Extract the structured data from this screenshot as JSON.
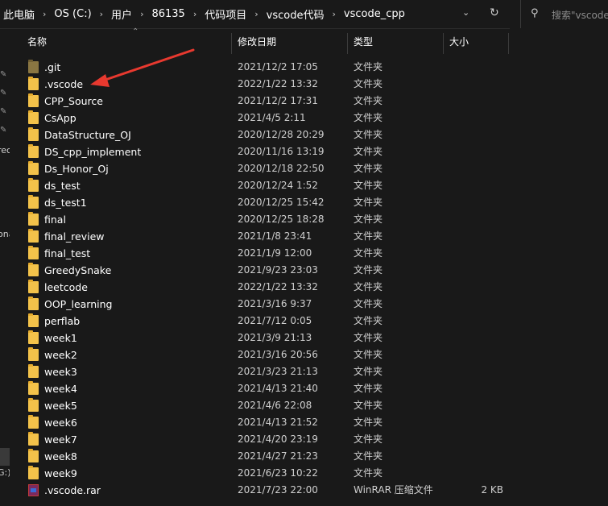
{
  "breadcrumb": [
    "此电脑",
    "OS (C:)",
    "用户",
    "86135",
    "代码项目",
    "vscode代码",
    "vscode_cpp"
  ],
  "search": {
    "placeholder": "搜索\"vscode"
  },
  "nav": {
    "labels": [
      "rec",
      "ona",
      "G:)"
    ]
  },
  "columns": {
    "name": "名称",
    "modified": "修改日期",
    "type": "类型",
    "size": "大小"
  },
  "files": [
    {
      "name": ".git",
      "modified": "2021/12/2 17:05",
      "type": "文件夹",
      "size": "",
      "icon": "hidden-folder-icon"
    },
    {
      "name": ".vscode",
      "modified": "2022/1/22 13:32",
      "type": "文件夹",
      "size": "",
      "icon": "folder-icon"
    },
    {
      "name": "CPP_Source",
      "modified": "2021/12/2 17:31",
      "type": "文件夹",
      "size": "",
      "icon": "folder-icon"
    },
    {
      "name": "CsApp",
      "modified": "2021/4/5 2:11",
      "type": "文件夹",
      "size": "",
      "icon": "folder-icon"
    },
    {
      "name": "DataStructure_OJ",
      "modified": "2020/12/28 20:29",
      "type": "文件夹",
      "size": "",
      "icon": "folder-icon"
    },
    {
      "name": "DS_cpp_implement",
      "modified": "2020/11/16 13:19",
      "type": "文件夹",
      "size": "",
      "icon": "folder-icon"
    },
    {
      "name": "Ds_Honor_Oj",
      "modified": "2020/12/18 22:50",
      "type": "文件夹",
      "size": "",
      "icon": "folder-icon"
    },
    {
      "name": "ds_test",
      "modified": "2020/12/24 1:52",
      "type": "文件夹",
      "size": "",
      "icon": "folder-icon"
    },
    {
      "name": "ds_test1",
      "modified": "2020/12/25 15:42",
      "type": "文件夹",
      "size": "",
      "icon": "folder-icon"
    },
    {
      "name": "final",
      "modified": "2020/12/25 18:28",
      "type": "文件夹",
      "size": "",
      "icon": "folder-icon"
    },
    {
      "name": "final_review",
      "modified": "2021/1/8 23:41",
      "type": "文件夹",
      "size": "",
      "icon": "folder-icon"
    },
    {
      "name": "final_test",
      "modified": "2021/1/9 12:00",
      "type": "文件夹",
      "size": "",
      "icon": "folder-icon"
    },
    {
      "name": "GreedySnake",
      "modified": "2021/9/23 23:03",
      "type": "文件夹",
      "size": "",
      "icon": "folder-icon"
    },
    {
      "name": "leetcode",
      "modified": "2022/1/22 13:32",
      "type": "文件夹",
      "size": "",
      "icon": "folder-icon"
    },
    {
      "name": "OOP_learning",
      "modified": "2021/3/16 9:37",
      "type": "文件夹",
      "size": "",
      "icon": "folder-icon"
    },
    {
      "name": "perflab",
      "modified": "2021/7/12 0:05",
      "type": "文件夹",
      "size": "",
      "icon": "folder-icon"
    },
    {
      "name": "week1",
      "modified": "2021/3/9 21:13",
      "type": "文件夹",
      "size": "",
      "icon": "folder-icon"
    },
    {
      "name": "week2",
      "modified": "2021/3/16 20:56",
      "type": "文件夹",
      "size": "",
      "icon": "folder-icon"
    },
    {
      "name": "week3",
      "modified": "2021/3/23 21:13",
      "type": "文件夹",
      "size": "",
      "icon": "folder-icon"
    },
    {
      "name": "week4",
      "modified": "2021/4/13 21:40",
      "type": "文件夹",
      "size": "",
      "icon": "folder-icon"
    },
    {
      "name": "week5",
      "modified": "2021/4/6 22:08",
      "type": "文件夹",
      "size": "",
      "icon": "folder-icon"
    },
    {
      "name": "week6",
      "modified": "2021/4/13 21:52",
      "type": "文件夹",
      "size": "",
      "icon": "folder-icon"
    },
    {
      "name": "week7",
      "modified": "2021/4/20 23:19",
      "type": "文件夹",
      "size": "",
      "icon": "folder-icon"
    },
    {
      "name": "week8",
      "modified": "2021/4/27 21:23",
      "type": "文件夹",
      "size": "",
      "icon": "folder-icon"
    },
    {
      "name": "week9",
      "modified": "2021/6/23 10:22",
      "type": "文件夹",
      "size": "",
      "icon": "folder-icon"
    },
    {
      "name": ".vscode.rar",
      "modified": "2021/7/23 22:00",
      "type": "WinRAR 压缩文件",
      "size": "2 KB",
      "icon": "winrar-archive-icon"
    }
  ],
  "colors": {
    "background": "#191919",
    "folder": "#f3c24a",
    "annotation_arrow": "#e8392f"
  }
}
